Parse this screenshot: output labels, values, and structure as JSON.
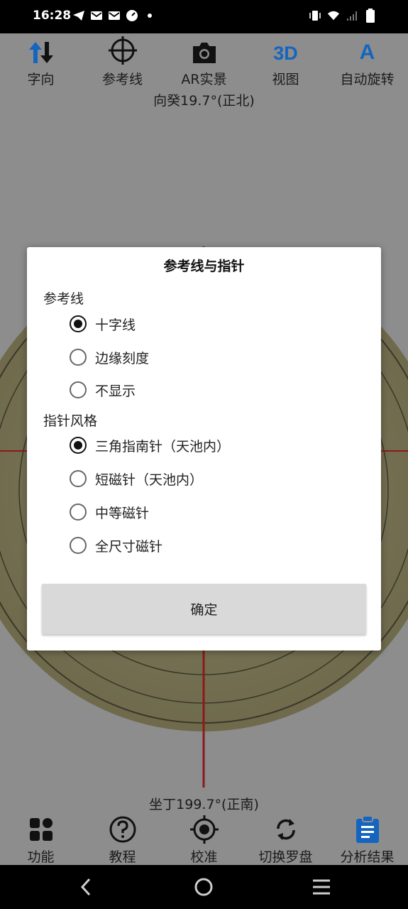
{
  "status_bar": {
    "time": "16:28",
    "left_icons": [
      "telegram-icon",
      "gmail-icon",
      "gmail-icon",
      "speed-icon",
      "dot-icon"
    ],
    "right_icons": [
      "vibrate-icon",
      "wifi-icon",
      "signal-icon",
      "battery-icon"
    ]
  },
  "toolbar": {
    "items": [
      {
        "label": "字向",
        "icon": "arrows-updown-icon"
      },
      {
        "label": "参考线",
        "icon": "crosshair-icon"
      },
      {
        "label": "AR实景",
        "icon": "camera-icon"
      },
      {
        "label": "视图",
        "icon": "3d-icon",
        "icon_text": "3D"
      },
      {
        "label": "自动旋转",
        "icon": "letter-a-icon",
        "icon_text": "A"
      }
    ]
  },
  "compass": {
    "heading_top": "向癸19.7°(正北)",
    "heading_bottom": "坐丁199.7°(正南)"
  },
  "bottom_nav": {
    "items": [
      {
        "label": "功能",
        "icon": "grid-icon"
      },
      {
        "label": "教程",
        "icon": "help-circle-icon"
      },
      {
        "label": "校准",
        "icon": "target-icon"
      },
      {
        "label": "切换罗盘",
        "icon": "refresh-icon"
      },
      {
        "label": "分析结果",
        "icon": "clipboard-icon"
      }
    ]
  },
  "dialog": {
    "title": "参考线与指针",
    "section_reference": "参考线",
    "reference_options": [
      {
        "label": "十字线",
        "checked": true
      },
      {
        "label": "边缘刻度",
        "checked": false
      },
      {
        "label": "不显示",
        "checked": false
      }
    ],
    "section_needle": "指针风格",
    "needle_options": [
      {
        "label": "三角指南针（天池内）",
        "checked": true
      },
      {
        "label": "短磁针（天池内）",
        "checked": false
      },
      {
        "label": "中等磁针",
        "checked": false
      },
      {
        "label": "全尺寸磁针",
        "checked": false
      }
    ],
    "confirm_label": "确定"
  },
  "colors": {
    "accent_blue": "#1565c0",
    "needle_red": "#c62828",
    "dim_background": "#8d8d8d"
  }
}
